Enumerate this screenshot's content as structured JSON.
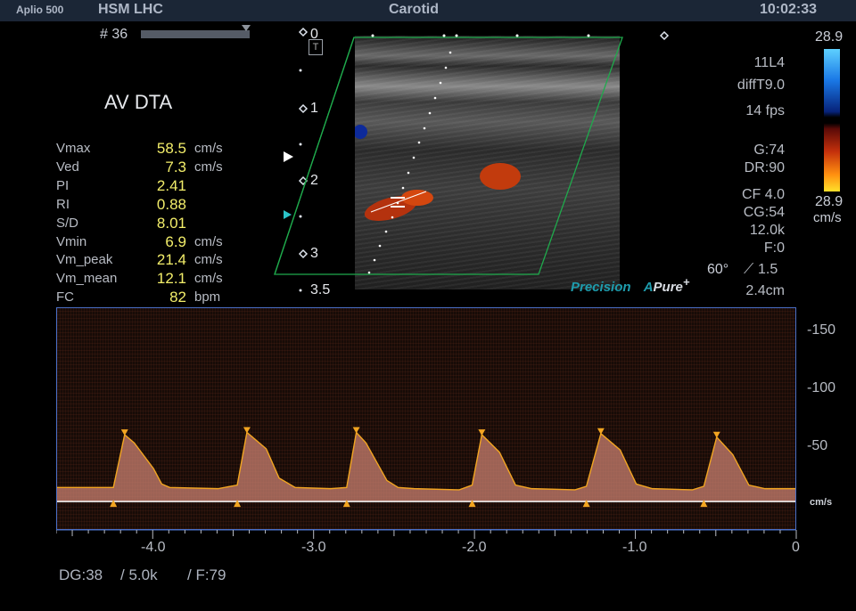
{
  "header": {
    "system": "Aplio 500",
    "facility": "HSM LHC",
    "exam": "Carotid",
    "time": "10:02:33"
  },
  "frame_index": "# 36",
  "measurement_title": "AV DTA",
  "measurements": [
    {
      "label": "Vmax",
      "value": "58.5",
      "unit": "cm/s"
    },
    {
      "label": "Ved",
      "value": "7.3",
      "unit": "cm/s"
    },
    {
      "label": "PI",
      "value": "2.41",
      "unit": ""
    },
    {
      "label": "RI",
      "value": "0.88",
      "unit": ""
    },
    {
      "label": "S/D",
      "value": "8.01",
      "unit": ""
    },
    {
      "label": "Vmin",
      "value": "6.9",
      "unit": "cm/s"
    },
    {
      "label": "Vm_peak",
      "value": "21.4",
      "unit": "cm/s"
    },
    {
      "label": "Vm_mean",
      "value": "12.1",
      "unit": "cm/s"
    },
    {
      "label": "FC",
      "value": "82",
      "unit": "bpm"
    }
  ],
  "depth_scale": [
    "0",
    "1",
    "2",
    "3",
    "3.5"
  ],
  "probe": {
    "model": "11L4",
    "preset": "diffT9.0",
    "fps": "14 fps",
    "gain": "G:74",
    "dynamic_range": "DR:90",
    "color_freq": "CF 4.0",
    "color_gain": "CG:54",
    "prf": "12.0k",
    "filter": "F:0",
    "angle": "60°",
    "sample_volume": "1.5",
    "depth": "2.4cm"
  },
  "color_scale": {
    "top": "28.9",
    "bottom": "28.9",
    "unit": "cm/s"
  },
  "brand": {
    "precision": "Precision",
    "pure": "Pure",
    "pure_prefix": "A",
    "plus": "+"
  },
  "doppler": {
    "velocity_unit": "cm/s",
    "bottom_params": {
      "dg": "DG:38",
      "prf": "/ 5.0k",
      "filter": "/ F:79"
    }
  },
  "chart_data": {
    "type": "line",
    "title": "",
    "xlabel": "",
    "ylabel": "cm/s",
    "x_ticks": [
      "-4.0",
      "-3.0",
      "-2.0",
      "-1.0",
      "0"
    ],
    "y_ticks": [
      "-150",
      "-100",
      "-50"
    ],
    "xlim": [
      -4.6,
      0
    ],
    "ylim": [
      -25,
      165
    ],
    "series": [
      {
        "values_description_only": false,
        "x": [
          -4.6,
          -4.25,
          -4.18,
          -4.12,
          -4.0,
          -3.95,
          -3.9,
          -3.6,
          -3.48,
          -3.42,
          -3.3,
          -3.22,
          -3.12,
          -2.9,
          -2.8,
          -2.74,
          -2.68,
          -2.55,
          -2.48,
          -2.38,
          -2.1,
          -2.02,
          -1.96,
          -1.85,
          -1.75,
          -1.65,
          -1.38,
          -1.31,
          -1.22,
          -1.1,
          -1.0,
          -0.9,
          -0.65,
          -0.58,
          -0.5,
          -0.4,
          -0.3,
          -0.2,
          0
        ],
        "y": [
          12,
          12,
          57,
          50,
          28,
          15,
          12,
          11,
          14,
          59,
          45,
          20,
          12,
          11,
          12,
          59,
          50,
          18,
          12,
          11,
          10,
          14,
          57,
          42,
          14,
          11,
          10,
          13,
          58,
          44,
          15,
          11,
          10,
          13,
          55,
          40,
          14,
          11,
          11
        ]
      }
    ]
  }
}
